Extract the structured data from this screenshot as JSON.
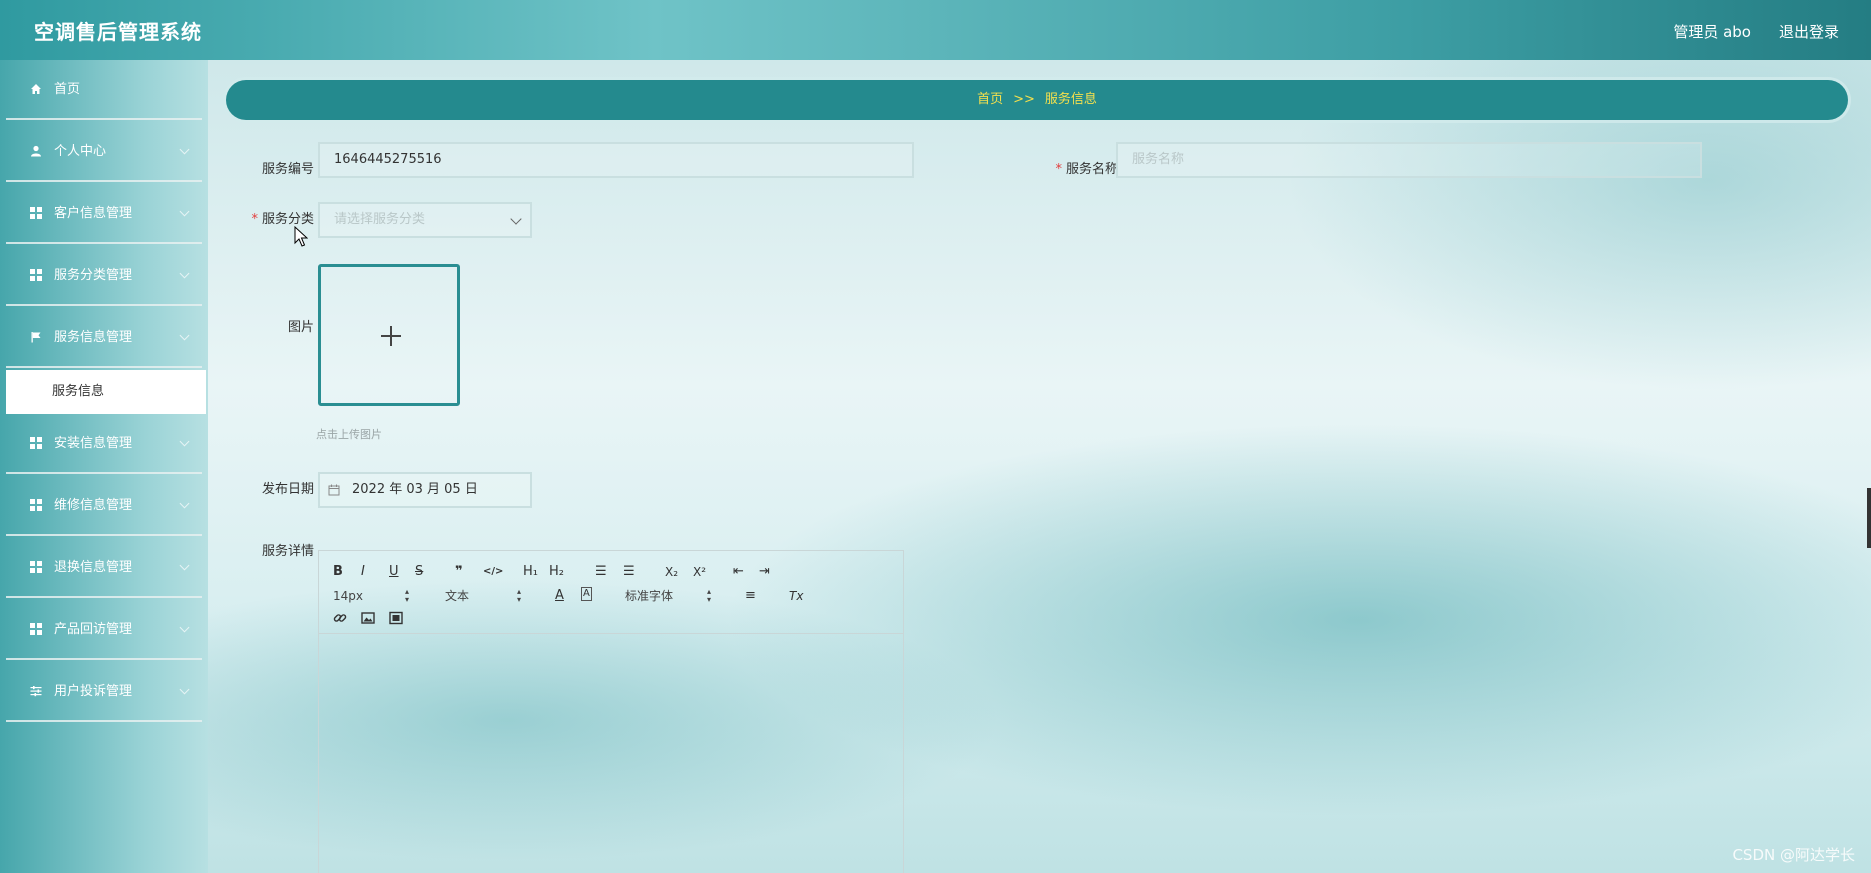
{
  "header": {
    "app_title": "空调售后管理系统",
    "user_label": "管理员 abo",
    "logout_label": "退出登录"
  },
  "sidebar": {
    "items": [
      {
        "label": "首页",
        "icon": "home-icon"
      },
      {
        "label": "个人中心",
        "icon": "user-icon"
      },
      {
        "label": "客户信息管理",
        "icon": "grid-icon"
      },
      {
        "label": "服务分类管理",
        "icon": "grid-icon"
      },
      {
        "label": "服务信息管理",
        "icon": "flag-icon"
      },
      {
        "label": "安装信息管理",
        "icon": "grid-icon"
      },
      {
        "label": "维修信息管理",
        "icon": "grid-icon"
      },
      {
        "label": "退换信息管理",
        "icon": "grid-icon"
      },
      {
        "label": "产品回访管理",
        "icon": "grid-icon"
      },
      {
        "label": "用户投诉管理",
        "icon": "sliders-icon"
      }
    ],
    "active_sub": "服务信息"
  },
  "breadcrumb": {
    "home": "首页",
    "separator": ">>",
    "current": "服务信息"
  },
  "form": {
    "service_no": {
      "label": "服务编号",
      "value": "1646445275516"
    },
    "service_name": {
      "label": "服务名称",
      "placeholder": "服务名称"
    },
    "service_category": {
      "label": "服务分类",
      "placeholder": "请选择服务分类"
    },
    "image": {
      "label": "图片",
      "hint": "点击上传图片"
    },
    "publish_date": {
      "label": "发布日期",
      "value": "2022 年 03 月 05 日"
    },
    "detail": {
      "label": "服务详情"
    }
  },
  "editor_toolbar": {
    "bold": "B",
    "italic": "I",
    "underline": "U",
    "strike": "S",
    "blockquote": "❞",
    "code": "</>",
    "h1": "H₁",
    "h2": "H₂",
    "ordered_list": "☰",
    "bullet_list": "☰",
    "subscript": "X₂",
    "superscript": "X²",
    "outdent": "⇤",
    "indent": "⇥",
    "font_size": "14px",
    "text_type": "文本",
    "font_color": "A",
    "background": "A",
    "font_family": "标准字体",
    "align": "≡",
    "clean": "Tx"
  },
  "watermark": "CSDN @阿达学长"
}
